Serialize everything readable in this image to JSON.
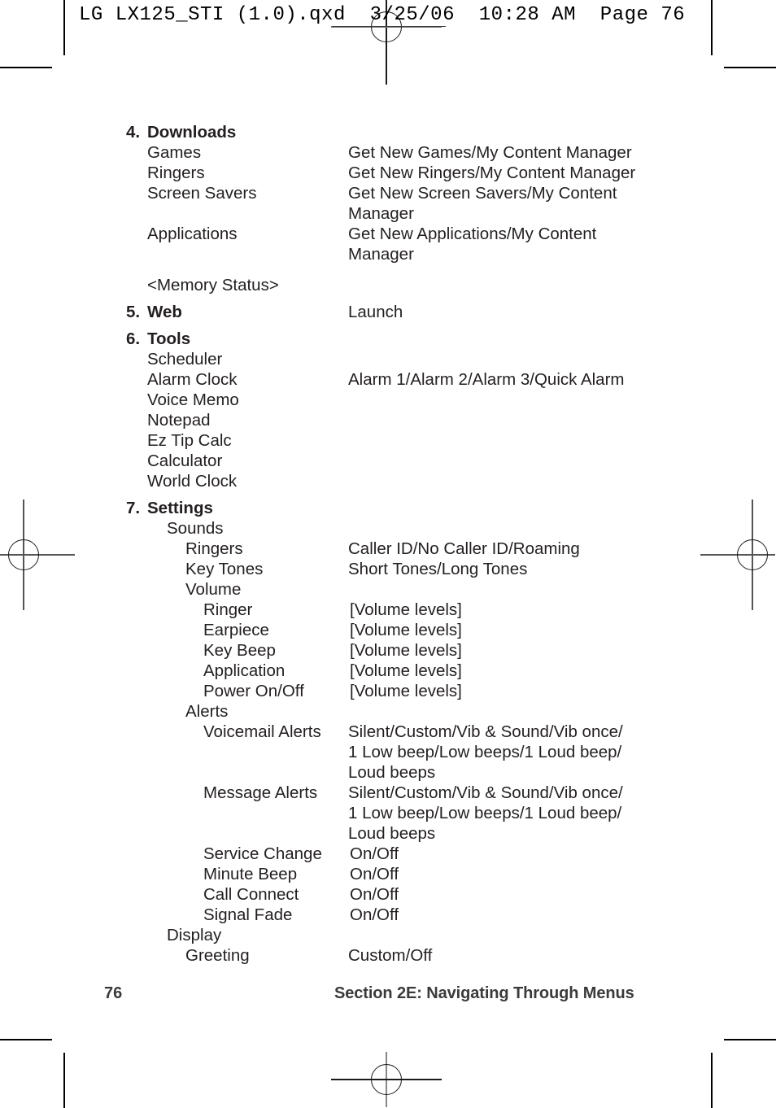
{
  "header": {
    "text": "LG LX125_STI (1.0).qxd  3/25/06  10:28 AM  Page 76"
  },
  "footer": {
    "page_number": "76",
    "section": "Section 2E: Navigating Through Menus"
  },
  "menu": {
    "sections": [
      {
        "number": "4.",
        "title": "Downloads",
        "rows": [
          {
            "indent": 1,
            "label": "Games",
            "value": "Get New Games/My Content Manager"
          },
          {
            "indent": 1,
            "label": "Ringers",
            "value": "Get New Ringers/My Content Manager"
          },
          {
            "indent": 1,
            "label": "Screen Savers",
            "value": "Get New Screen Savers/My Content"
          },
          {
            "indent": 1,
            "label": "",
            "value": "Manager"
          },
          {
            "indent": 1,
            "label": "Applications",
            "value": "Get New Applications/My Content"
          },
          {
            "indent": 1,
            "label": "",
            "value": "Manager"
          },
          {
            "indent": 1,
            "label": "<Memory Status>",
            "value": "",
            "spacer_before": true
          }
        ]
      },
      {
        "number": "5.",
        "title": "Web",
        "title_value": "Launch",
        "rows": []
      },
      {
        "number": "6.",
        "title": "Tools",
        "rows": [
          {
            "indent": 1,
            "label": "Scheduler",
            "value": ""
          },
          {
            "indent": 1,
            "label": "Alarm Clock",
            "value": "Alarm 1/Alarm 2/Alarm 3/Quick Alarm"
          },
          {
            "indent": 1,
            "label": "Voice Memo",
            "value": ""
          },
          {
            "indent": 1,
            "label": "Notepad",
            "value": ""
          },
          {
            "indent": 1,
            "label": "Ez Tip Calc",
            "value": ""
          },
          {
            "indent": 1,
            "label": "Calculator",
            "value": ""
          },
          {
            "indent": 1,
            "label": "World Clock",
            "value": ""
          }
        ]
      },
      {
        "number": "7.",
        "title": "Settings",
        "rows": [
          {
            "indent": 2,
            "label": "Sounds",
            "value": ""
          },
          {
            "indent": 3,
            "label": "Ringers",
            "value": "Caller ID/No Caller ID/Roaming"
          },
          {
            "indent": 3,
            "label": "Key Tones",
            "value": "Short Tones/Long Tones"
          },
          {
            "indent": 3,
            "label": "Volume",
            "value": ""
          },
          {
            "indent": 4,
            "label": "Ringer",
            "value": "[Volume levels]",
            "narrow": true
          },
          {
            "indent": 4,
            "label": "Earpiece",
            "value": "[Volume levels]",
            "narrow": true
          },
          {
            "indent": 4,
            "label": "Key Beep",
            "value": "[Volume levels]",
            "narrow": true
          },
          {
            "indent": 4,
            "label": "Application",
            "value": "[Volume levels]",
            "narrow": true
          },
          {
            "indent": 4,
            "label": "Power On/Off",
            "value": "[Volume levels]",
            "narrow": true
          },
          {
            "indent": 3,
            "label": "Alerts",
            "value": ""
          },
          {
            "indent": 4,
            "label": "Voicemail Alerts",
            "value": "Silent/Custom/Vib & Sound/Vib once/"
          },
          {
            "indent": 4,
            "label": "",
            "value": "1 Low beep/Low beeps/1 Loud beep/"
          },
          {
            "indent": 4,
            "label": "",
            "value": "Loud beeps"
          },
          {
            "indent": 4,
            "label": "Message Alerts",
            "value": "Silent/Custom/Vib & Sound/Vib once/"
          },
          {
            "indent": 4,
            "label": "",
            "value": "1 Low beep/Low beeps/1 Loud beep/"
          },
          {
            "indent": 4,
            "label": "",
            "value": "Loud beeps"
          },
          {
            "indent": 4,
            "label": "Service Change",
            "value": "On/Off",
            "narrow": true
          },
          {
            "indent": 4,
            "label": "Minute Beep",
            "value": "On/Off",
            "narrow": true
          },
          {
            "indent": 4,
            "label": "Call Connect",
            "value": "On/Off",
            "narrow": true
          },
          {
            "indent": 4,
            "label": "Signal Fade",
            "value": "On/Off",
            "narrow": true
          },
          {
            "indent": 2,
            "label": "Display",
            "value": ""
          },
          {
            "indent": 3,
            "label": "Greeting",
            "value": "Custom/Off"
          }
        ]
      }
    ]
  }
}
